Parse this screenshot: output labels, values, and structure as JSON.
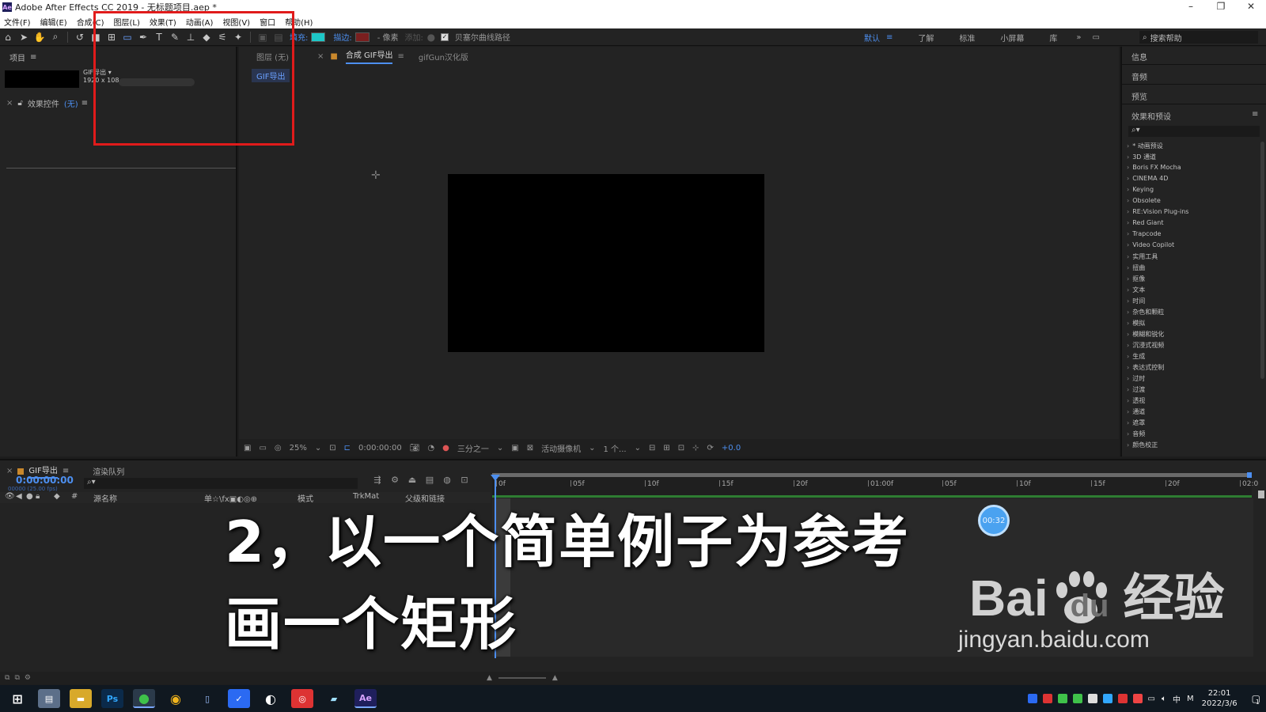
{
  "window": {
    "title": "Adobe After Effects CC 2019 - 无标题项目.aep *",
    "app_icon": "Ae",
    "controls": [
      "–",
      "❐",
      "✕"
    ]
  },
  "menu": [
    "文件(F)",
    "编辑(E)",
    "合成(C)",
    "图层(L)",
    "效果(T)",
    "动画(A)",
    "视图(V)",
    "窗口",
    "帮助(H)"
  ],
  "toolbar": {
    "fill_label": "填充:",
    "fill_color": "#1ec8c8",
    "stroke_label": "描边:",
    "stroke_color": "#7a1f1f",
    "pixel_label": "- 像素",
    "add_label": "添加:",
    "bezier_label": "贝塞尔曲线路径",
    "workspaces": [
      "默认",
      "了解",
      "标准",
      "小屏幕",
      "库"
    ],
    "more": "»",
    "search_help": "搜索帮助"
  },
  "project_panel": {
    "title": "项目",
    "item_name": "GIF导出",
    "item_size": "1920 x 108",
    "effects_title": "效果控件",
    "effects_target": "(无)"
  },
  "viewer": {
    "tabs": [
      "图层 (无)",
      "合成 GIF导出",
      "gifGun汉化版"
    ],
    "comp_chip": "GIF导出",
    "zoom": "25%",
    "timecode": "0:00:00:00",
    "resolution": "三分之一",
    "camera": "活动摄像机",
    "views": "1 个...",
    "exposure": "+0.0"
  },
  "right_panel": {
    "info": "信息",
    "audio": "音频",
    "preview": "预览",
    "effects_presets": "效果和预设",
    "items": [
      "* 动画预设",
      "3D 通道",
      "Boris FX Mocha",
      "CINEMA 4D",
      "Keying",
      "Obsolete",
      "RE:Vision Plug-ins",
      "Red Giant",
      "Trapcode",
      "Video Copilot",
      "实用工具",
      "扭曲",
      "抠像",
      "文本",
      "时间",
      "杂色和颗粒",
      "模拟",
      "模糊和锐化",
      "沉浸式视频",
      "生成",
      "表达式控制",
      "过时",
      "过渡",
      "透视",
      "通道",
      "遮罩",
      "音频",
      "颜色校正"
    ]
  },
  "timeline": {
    "tab_comp": "GIF导出",
    "tab_render": "渲染队列",
    "timecode": "0:00:00:00",
    "fps": "00000 (25.00 fps)",
    "col_source": "源名称",
    "col_mode": "模式",
    "col_trkmat": "TrkMat",
    "col_parent": "父级和链接",
    "ruler": [
      "0f",
      "05f",
      "10f",
      "15f",
      "20f",
      "01:00f",
      "05f",
      "10f",
      "15f",
      "20f",
      "02:0"
    ]
  },
  "overlay": {
    "caption_line1": "2，以一个简单例子为参考",
    "caption_line2": "画一个矩形",
    "timer": "00:32",
    "watermark_brand": "Bai",
    "watermark_du": "du",
    "watermark_cn": "经验",
    "watermark_url": "jingyan.baidu.com"
  },
  "taskbar": {
    "apps": [
      "Ps",
      "Ae"
    ],
    "time": "22:01",
    "date": "2022/3/6",
    "ime": "中",
    "notify": "1"
  }
}
